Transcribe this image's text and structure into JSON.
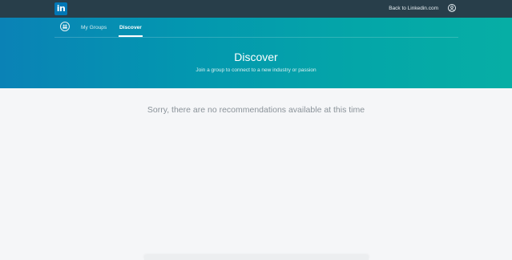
{
  "topbar": {
    "logo_text": "in",
    "back_link": "Back to Linkedin.com",
    "profile_icon": "user-circle-icon"
  },
  "nav": {
    "groups_icon": "groups-icon",
    "tabs": [
      {
        "label": "My Groups",
        "active": false
      },
      {
        "label": "Discover",
        "active": true
      }
    ]
  },
  "hero": {
    "title": "Discover",
    "subtitle": "Join a group to connect to a new industry or passion"
  },
  "main": {
    "empty_message": "Sorry, there are no recommendations available at this time"
  },
  "colors": {
    "topbar": "#283e4a",
    "brand_blue": "#0077b5",
    "hero_left": "#0a82b6",
    "hero_right": "#06aea5"
  }
}
